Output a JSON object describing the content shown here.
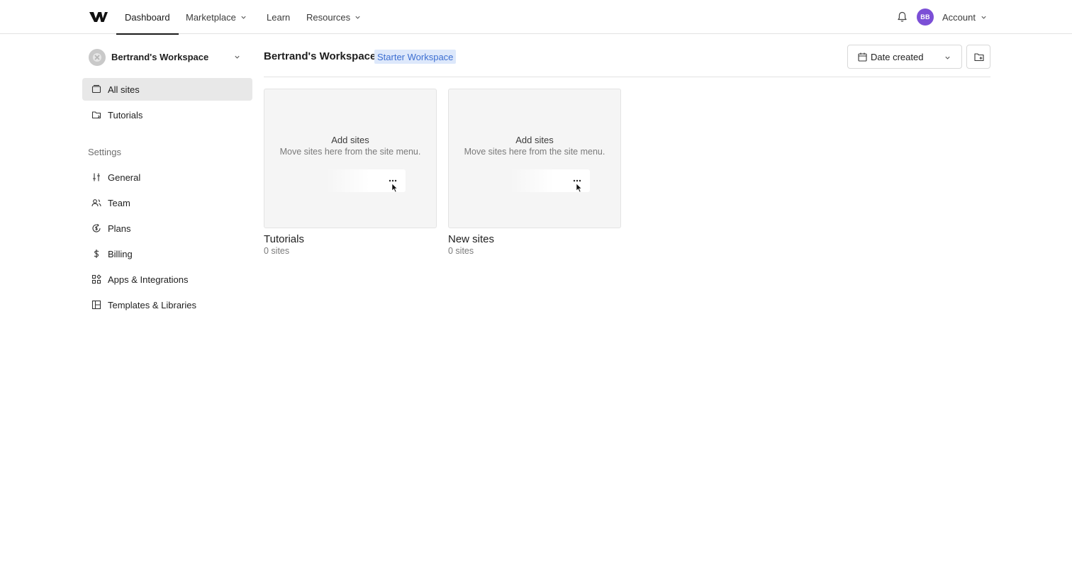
{
  "nav": {
    "items": [
      {
        "label": "Dashboard",
        "active": true
      },
      {
        "label": "Marketplace",
        "dropdown": true
      },
      {
        "label": "Learn"
      },
      {
        "label": "Resources",
        "dropdown": true
      }
    ],
    "avatar_initials": "BB",
    "avatar_color": "#7b4fd6",
    "account_label": "Account"
  },
  "sidebar": {
    "workspace_name": "Bertrand's Workspace",
    "items": [
      {
        "label": "All sites",
        "icon": "browser-window-icon",
        "selected": true
      },
      {
        "label": "Tutorials",
        "icon": "folder-icon"
      }
    ],
    "settings_label": "Settings",
    "settings_items": [
      {
        "label": "General",
        "icon": "sliders-icon"
      },
      {
        "label": "Team",
        "icon": "users-icon"
      },
      {
        "label": "Plans",
        "icon": "refresh-dollar-icon"
      },
      {
        "label": "Billing",
        "icon": "dollar-icon"
      },
      {
        "label": "Apps & Integrations",
        "icon": "apps-grid-icon"
      },
      {
        "label": "Templates & Libraries",
        "icon": "layout-icon"
      }
    ]
  },
  "main": {
    "title": "Bertrand's Workspace",
    "badge": "Starter Workspace",
    "badge_color": "#3d6fd1",
    "sort_label": "Date created",
    "folders": [
      {
        "name": "Tutorials",
        "count": "0 sites",
        "empty_title": "Add sites",
        "empty_desc": "Move sites here from the site menu."
      },
      {
        "name": "New sites",
        "count": "0 sites",
        "empty_title": "Add sites",
        "empty_desc": "Move sites here from the site menu."
      }
    ]
  }
}
